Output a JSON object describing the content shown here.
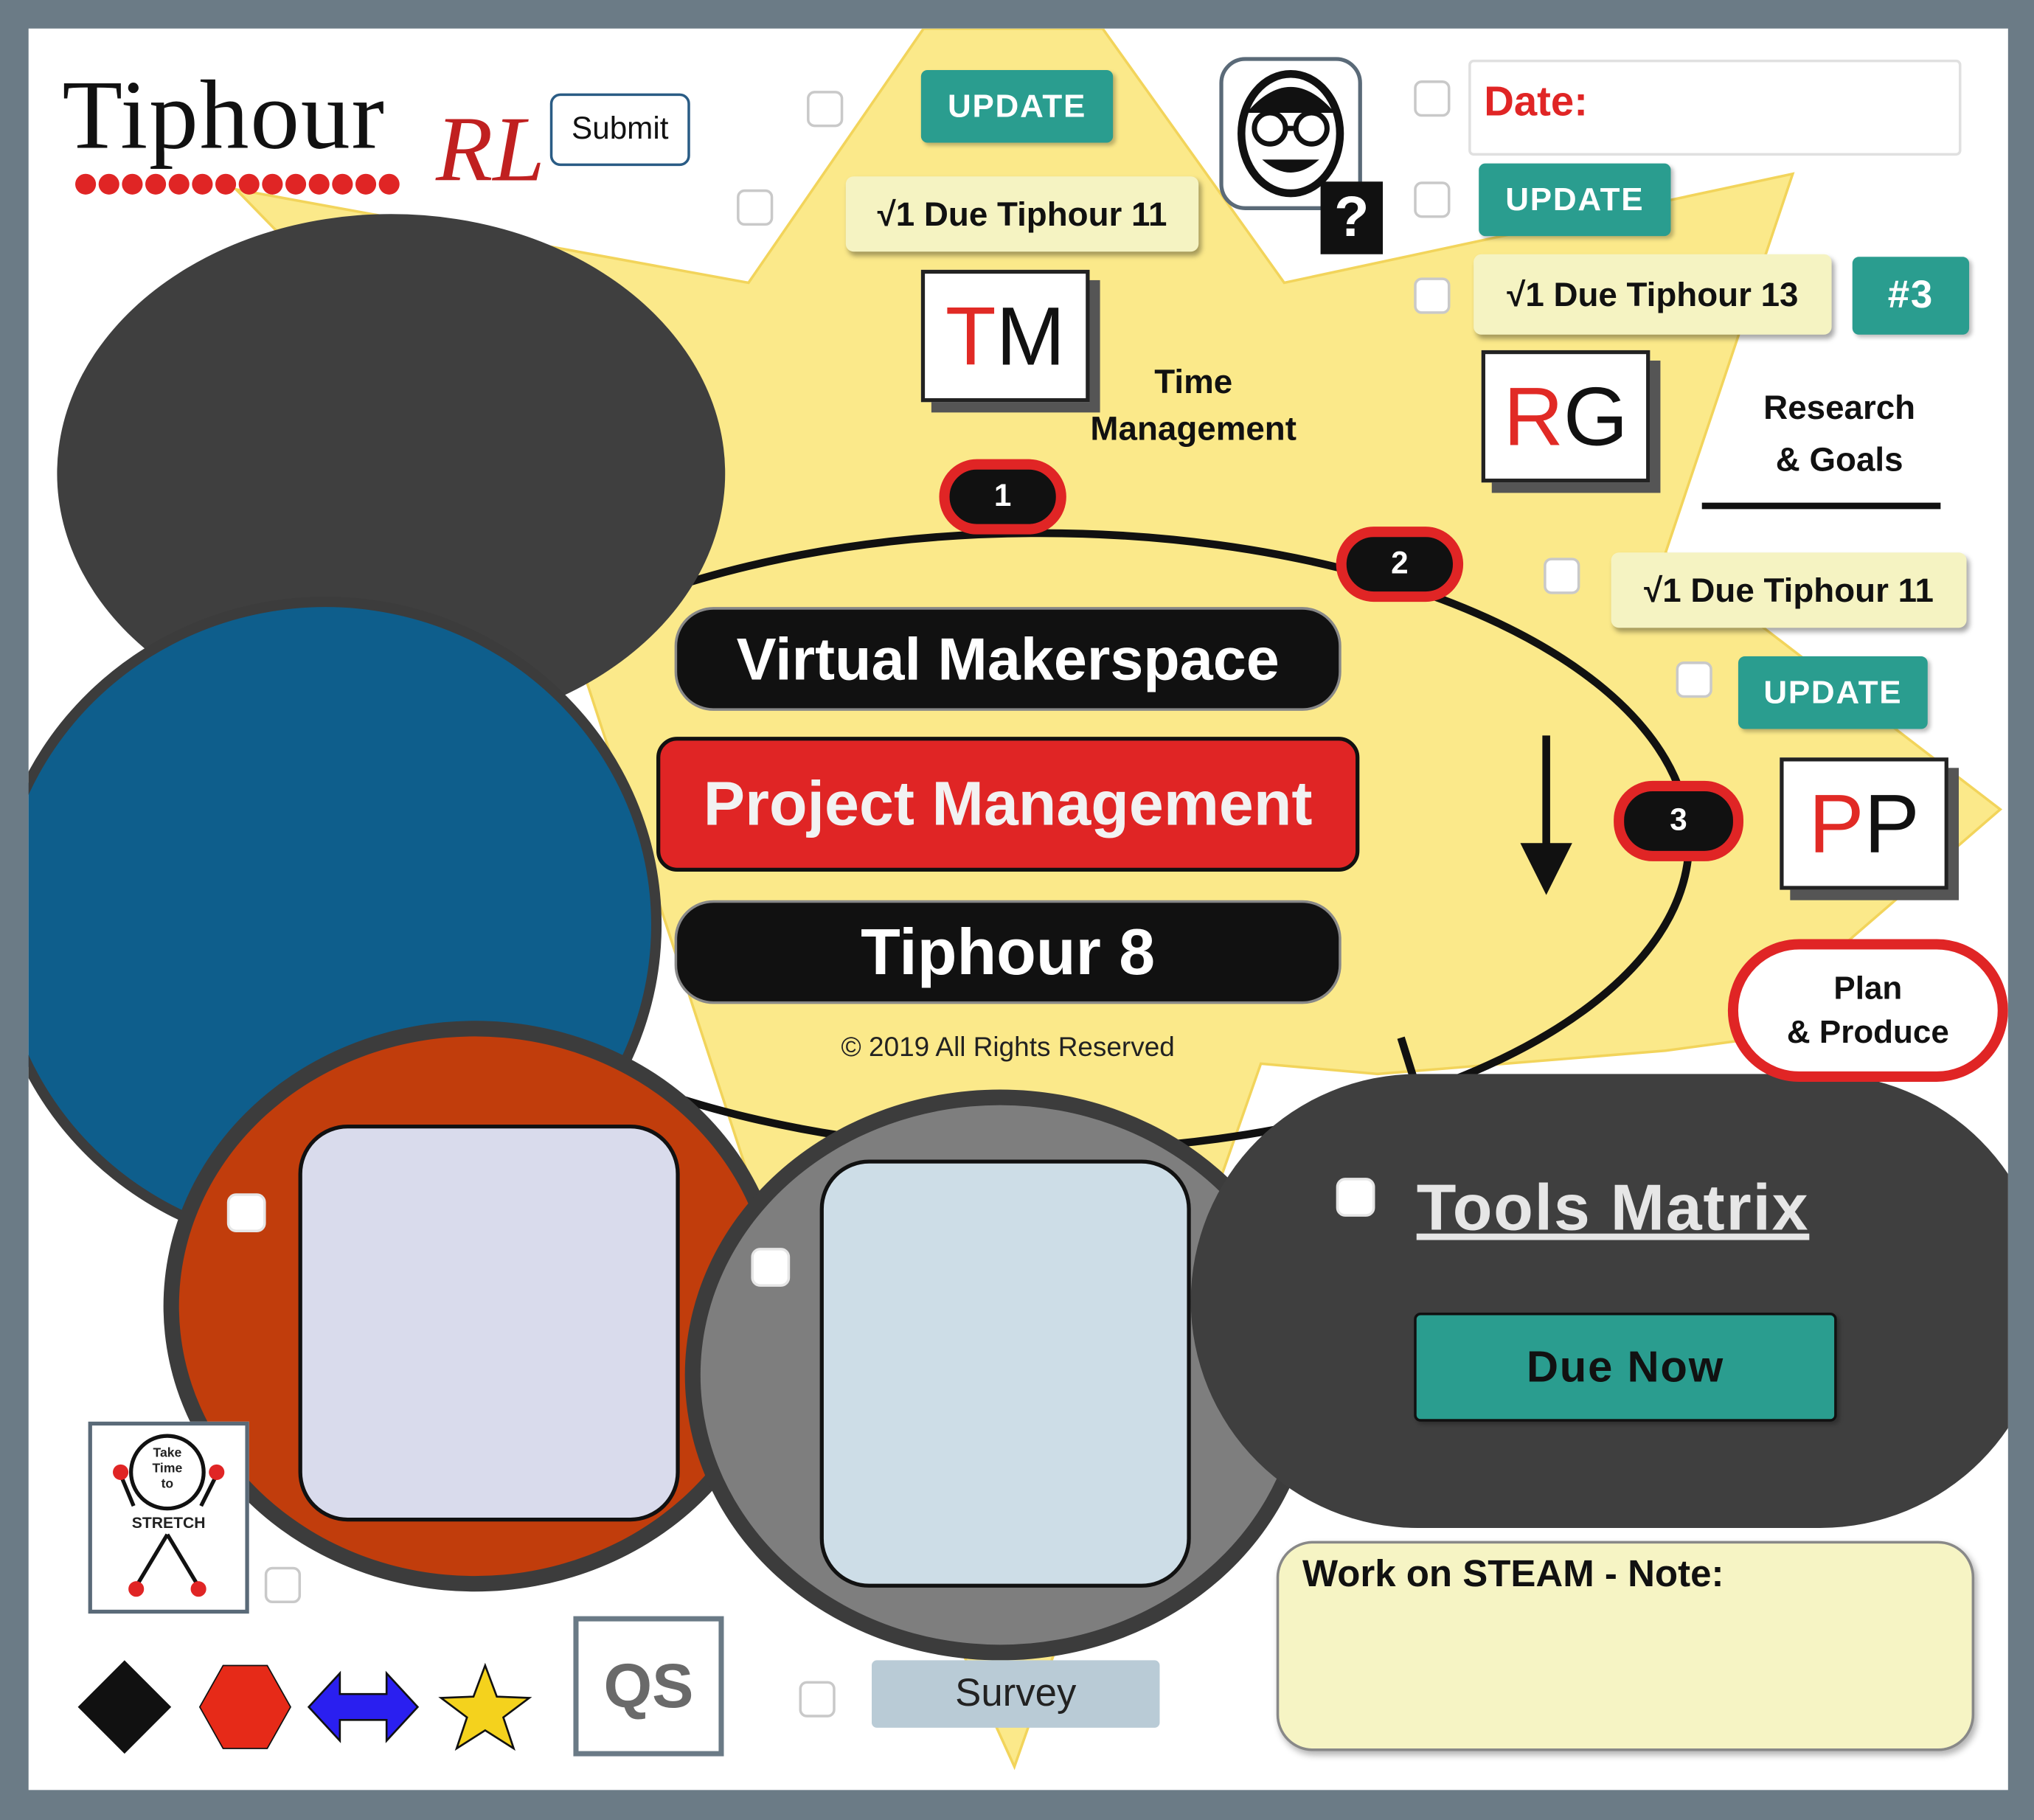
{
  "header": {
    "logo_text": "Tiphour",
    "logo_mark": "RL",
    "submit_label": "Submit",
    "date_placeholder": "Date:"
  },
  "buttons": {
    "update_top": "UPDATE",
    "update_right": "UPDATE",
    "update_mid": "UPDATE",
    "badge_number": "#3",
    "due_now": "Due Now"
  },
  "due_labels": {
    "tm": "√1 Due Tiphour 11",
    "rg": "√1 Due Tiphour 13",
    "pp": "√1 Due Tiphour 11"
  },
  "cards": {
    "tm": {
      "letter1": "T",
      "letter2": "M",
      "label_line1": "Time",
      "label_line2": "Management"
    },
    "rg": {
      "letter1": "R",
      "letter2": "G",
      "label_line1": "Research",
      "label_line2": "& Goals"
    },
    "pp": {
      "letter1": "P",
      "letter2": "P",
      "label_line1": "Plan",
      "label_line2": "& Produce"
    }
  },
  "steps": [
    "1",
    "2",
    "3"
  ],
  "center": {
    "line1": "Virtual Makerspace",
    "line2": "Project Management",
    "line3": "Tiphour 8",
    "copyright": "© 2019 All Rights Reserved"
  },
  "tools": {
    "link": "Tools Matrix"
  },
  "note": {
    "title": "Work on STEAM - Note:"
  },
  "stretch": {
    "line1": "Take",
    "line2": "Time",
    "line3": "to",
    "line4": "STRETCH"
  },
  "bottom": {
    "qs_label": "QS",
    "survey_label": "Survey"
  },
  "help_glyph": "?",
  "colors": {
    "star_yellow": "#fbe98a",
    "dark_circle": "#3f3f3f",
    "blue_circle": "#0e5e8c",
    "orange_circle": "#c13d0c",
    "gray_circle": "#7e7e7e",
    "teal": "#2a9d8f",
    "red": "#e02525",
    "lavender": "#d9dbec",
    "light_blue": "#cddde7",
    "note_yellow": "#f6f4c4"
  },
  "icons": [
    "black-diamond-icon",
    "red-hexagon-icon",
    "blue-double-arrow-icon",
    "gold-star-icon",
    "help-question-icon",
    "avatar-face-icon"
  ]
}
